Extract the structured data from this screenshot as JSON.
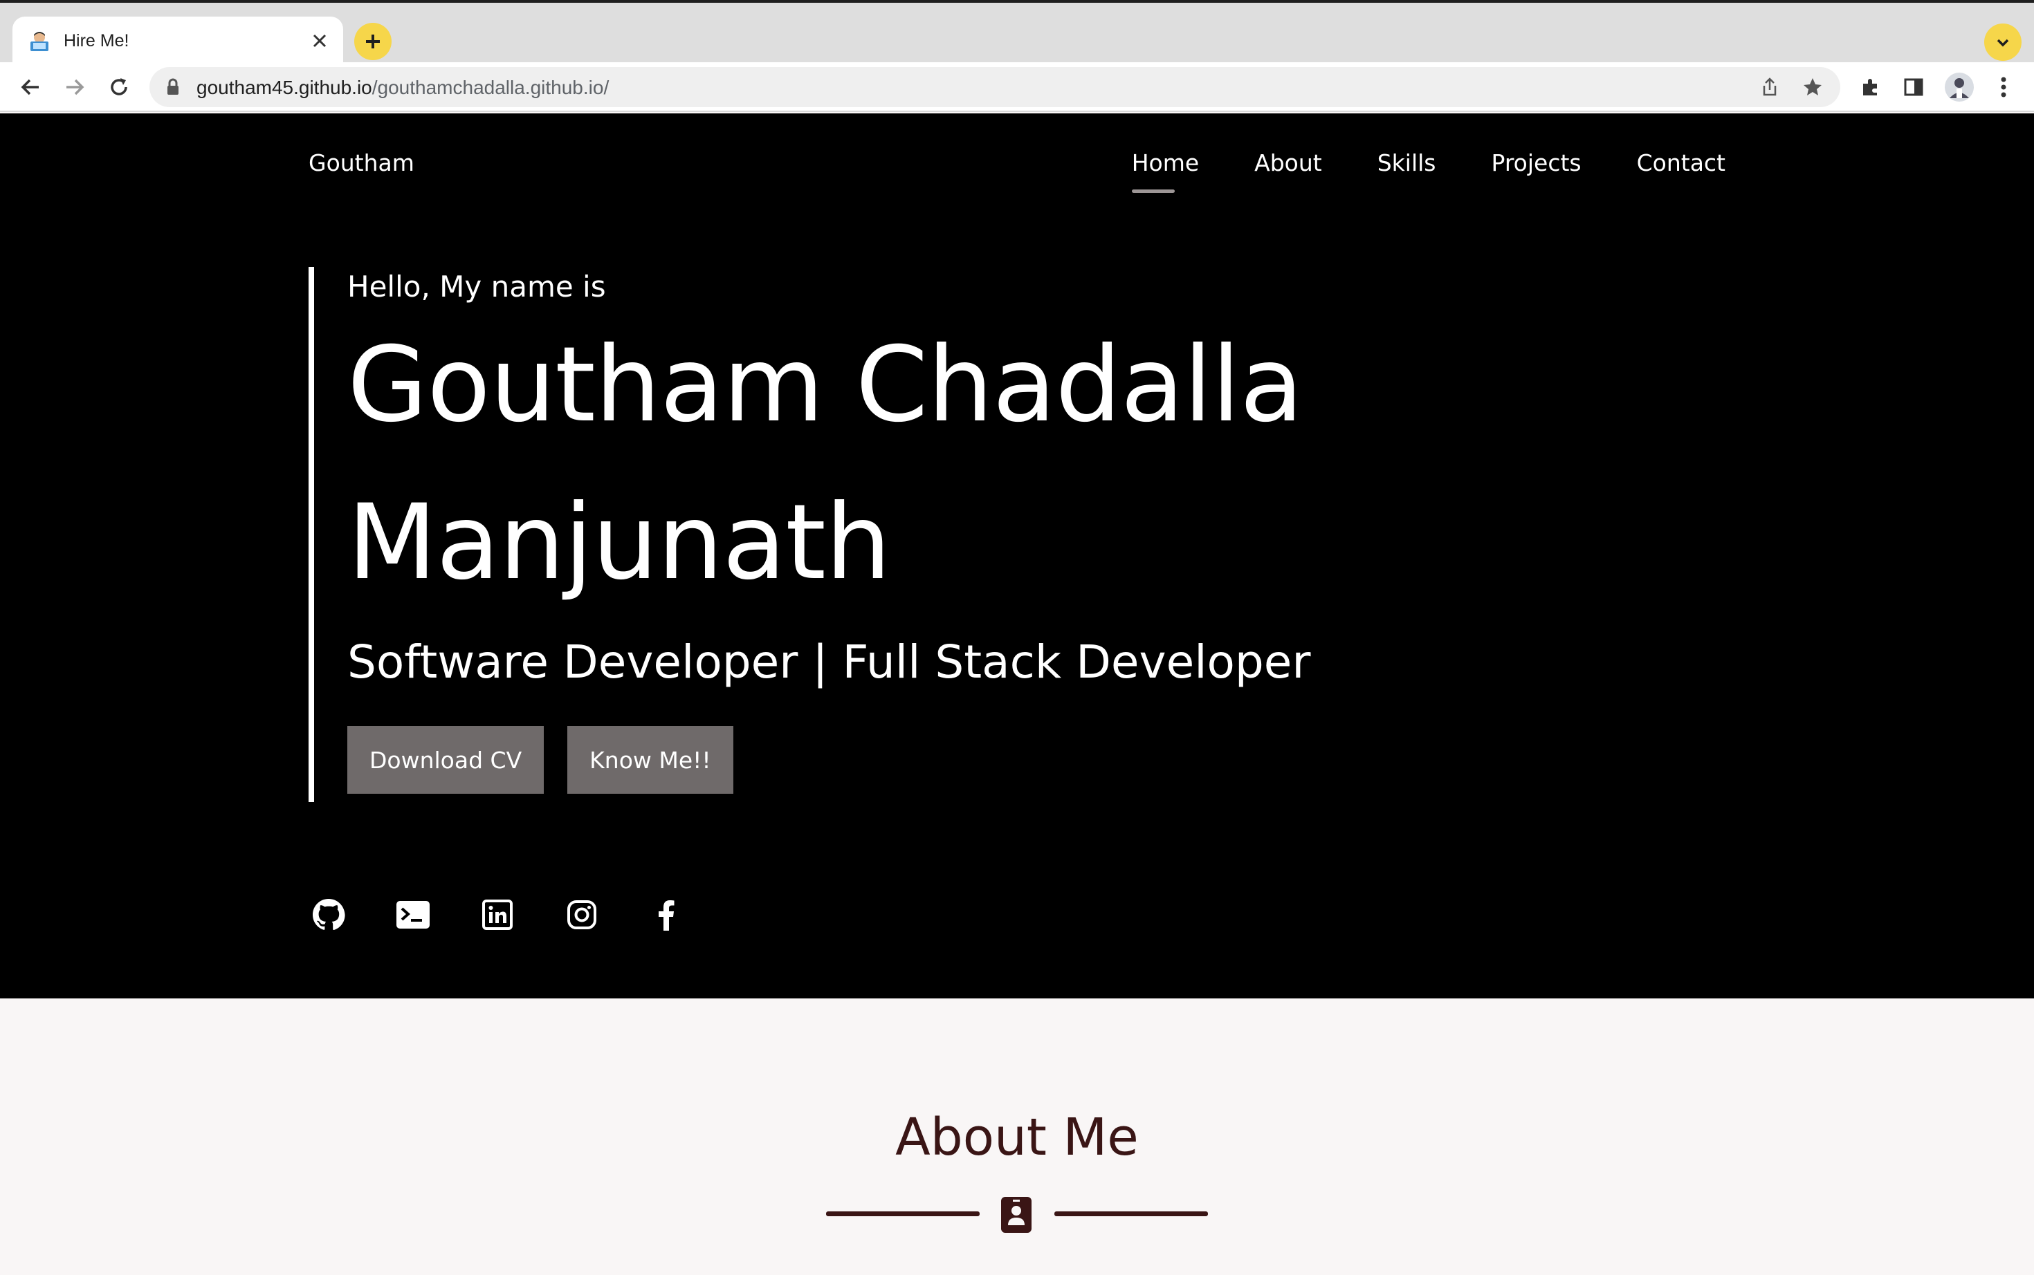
{
  "browser": {
    "tab_title": "Hire Me!",
    "url_host": "goutham45.github.io",
    "url_path": "/gouthamchadalla.github.io/",
    "accent": "#f6d64a"
  },
  "site": {
    "brand": "Goutham",
    "nav": [
      {
        "label": "Home",
        "active": true
      },
      {
        "label": "About",
        "active": false
      },
      {
        "label": "Skills",
        "active": false
      },
      {
        "label": "Projects",
        "active": false
      },
      {
        "label": "Contact",
        "active": false
      }
    ]
  },
  "hero": {
    "greeting": "Hello, My name is",
    "name_line1": "Goutham Chadalla",
    "name_line2": "Manjunath",
    "role": "Software Developer | Full Stack Developer",
    "cv_button": "Download CV",
    "know_button": "Know Me!!",
    "button_color": "#6f6a6a"
  },
  "socials": [
    "github-icon",
    "terminal-icon",
    "linkedin-icon",
    "instagram-icon",
    "facebook-icon"
  ],
  "about": {
    "title": "About Me",
    "accent": "#3a1515"
  }
}
